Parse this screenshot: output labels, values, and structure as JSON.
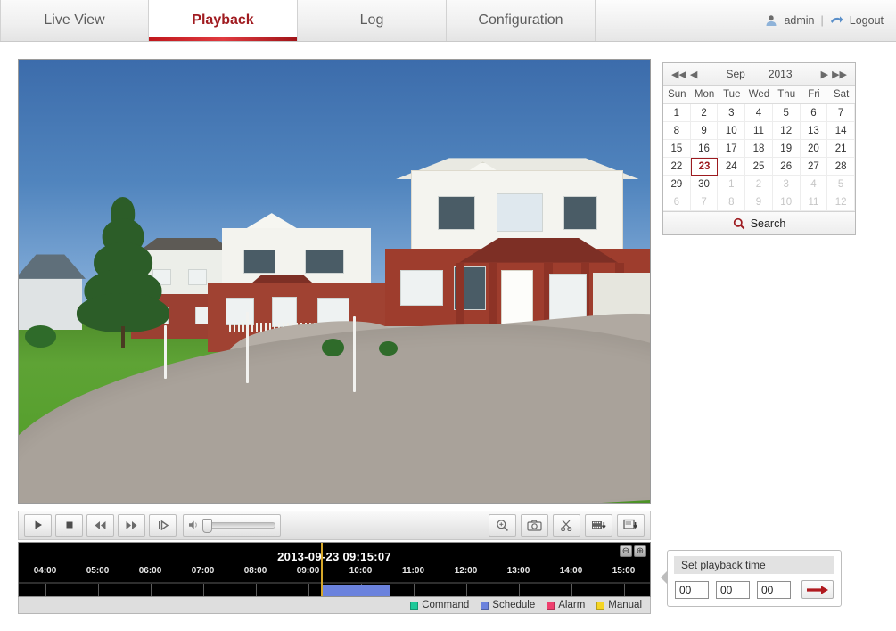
{
  "header": {
    "tabs": [
      {
        "label": "Live View",
        "active": false
      },
      {
        "label": "Playback",
        "active": true
      },
      {
        "label": "Log",
        "active": false
      },
      {
        "label": "Configuration",
        "active": false
      }
    ],
    "user": "admin",
    "separator": "|",
    "logout": "Logout",
    "user_icon": "user-icon",
    "logout_icon": "logout-icon",
    "active_tab_color": "#a01b20"
  },
  "video": {
    "description": "Live playback video frame showing a residential street with red brick and white houses, a spruce tree on the left, green lawn and a curving concrete driveway under a clear blue sky"
  },
  "controls": {
    "play": "play-button",
    "stop": "stop-button",
    "rewind": "rewind-button",
    "forward": "fast-forward-button",
    "frame": "single-frame-button",
    "volume_label": "volume-slider",
    "volume_value": 8,
    "zoom_in": "digital-zoom-button",
    "capture": "snapshot-button",
    "clip": "clip-button",
    "download_video": "download-video-button",
    "download_file": "download-file-button"
  },
  "timeline": {
    "current_time": "2013-09-23 09:15:07",
    "zoom_out_label": "⊖",
    "zoom_in_label": "⊕",
    "hour_labels": [
      "04:00",
      "05:00",
      "06:00",
      "07:00",
      "08:00",
      "09:00",
      "10:00",
      "11:00",
      "12:00",
      "13:00",
      "14:00",
      "15:00"
    ],
    "start_hour": 3.5,
    "end_hour": 15.5,
    "playhead_hour": 9.25,
    "segments": [
      {
        "type": "Schedule",
        "start_hour": 9.25,
        "end_hour": 10.55,
        "color": "#6b82dd"
      }
    ],
    "legend": [
      {
        "label": "Command",
        "color": "#1ec999"
      },
      {
        "label": "Schedule",
        "color": "#6b82dd"
      },
      {
        "label": "Alarm",
        "color": "#ef3f6e"
      },
      {
        "label": "Manual",
        "color": "#f5d524"
      }
    ]
  },
  "calendar": {
    "prev_year_icon": "double-left-arrow-icon",
    "prev_month_icon": "left-arrow-icon",
    "month": "Sep",
    "year": "2013",
    "next_month_icon": "right-arrow-icon",
    "next_year_icon": "double-right-arrow-icon",
    "weekdays": [
      "Sun",
      "Mon",
      "Tue",
      "Wed",
      "Thu",
      "Fri",
      "Sat"
    ],
    "weeks": [
      [
        {
          "d": "1"
        },
        {
          "d": "2"
        },
        {
          "d": "3"
        },
        {
          "d": "4"
        },
        {
          "d": "5"
        },
        {
          "d": "6"
        },
        {
          "d": "7"
        }
      ],
      [
        {
          "d": "8"
        },
        {
          "d": "9"
        },
        {
          "d": "10"
        },
        {
          "d": "11"
        },
        {
          "d": "12"
        },
        {
          "d": "13"
        },
        {
          "d": "14"
        }
      ],
      [
        {
          "d": "15"
        },
        {
          "d": "16"
        },
        {
          "d": "17"
        },
        {
          "d": "18"
        },
        {
          "d": "19"
        },
        {
          "d": "20"
        },
        {
          "d": "21"
        }
      ],
      [
        {
          "d": "22"
        },
        {
          "d": "23",
          "sel": true
        },
        {
          "d": "24"
        },
        {
          "d": "25"
        },
        {
          "d": "26"
        },
        {
          "d": "27"
        },
        {
          "d": "28"
        }
      ],
      [
        {
          "d": "29"
        },
        {
          "d": "30"
        },
        {
          "d": "1",
          "other": true
        },
        {
          "d": "2",
          "other": true
        },
        {
          "d": "3",
          "other": true
        },
        {
          "d": "4",
          "other": true
        },
        {
          "d": "5",
          "other": true
        }
      ],
      [
        {
          "d": "6",
          "other": true
        },
        {
          "d": "7",
          "other": true
        },
        {
          "d": "8",
          "other": true
        },
        {
          "d": "9",
          "other": true
        },
        {
          "d": "10",
          "other": true
        },
        {
          "d": "11",
          "other": true
        },
        {
          "d": "12",
          "other": true
        }
      ]
    ],
    "selected_day": "23",
    "search_label": "Search",
    "search_icon": "search-icon"
  },
  "set_playback": {
    "title": "Set playback time",
    "hours": "00",
    "minutes": "00",
    "seconds": "00",
    "go_icon": "right-arrow-icon"
  }
}
